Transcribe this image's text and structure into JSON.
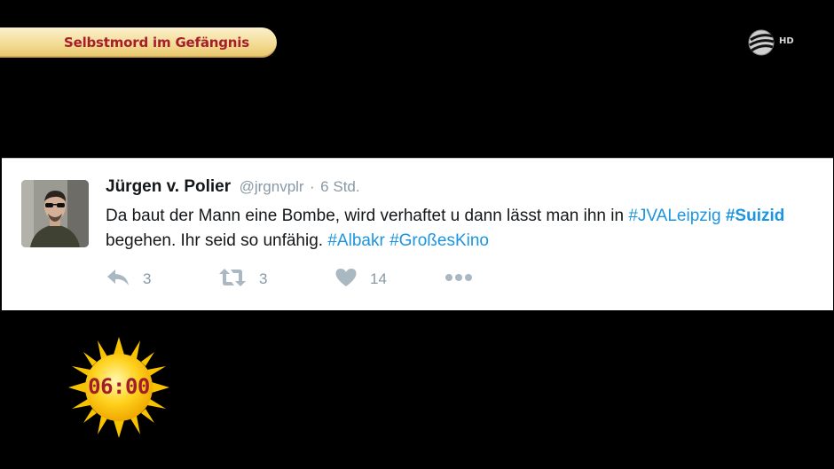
{
  "banner": {
    "title": "Selbstmord im Gefängnis"
  },
  "channel": {
    "hd_label": "HD"
  },
  "tweet": {
    "author_name": "Jürgen v. Polier",
    "handle": "@jrgnvplr",
    "separator": "·",
    "time": "6 Std.",
    "text": {
      "part1": "Da baut der Mann eine Bombe, wird verhaftet u dann lässt man ihn in ",
      "hashtag1": "#JVALeipzig",
      "space1": " ",
      "hashtag2": "#Suizid",
      "part2": " begehen. Ihr seid so unfähig. ",
      "hashtag3": "#Albakr",
      "space2": " ",
      "hashtag4": "#GroßesKino"
    },
    "actions": {
      "reply_count": "3",
      "retweet_count": "3",
      "like_count": "14"
    }
  },
  "clock": {
    "time": "06:00"
  },
  "colors": {
    "banner_text": "#a61d2c",
    "hashtag": "#1b95e0",
    "muted": "#8899a6",
    "sun": "#f6c400"
  },
  "icons": [
    "sport-channel-logo",
    "reply-icon",
    "retweet-icon",
    "heart-icon",
    "more-icon",
    "sun-icon"
  ]
}
